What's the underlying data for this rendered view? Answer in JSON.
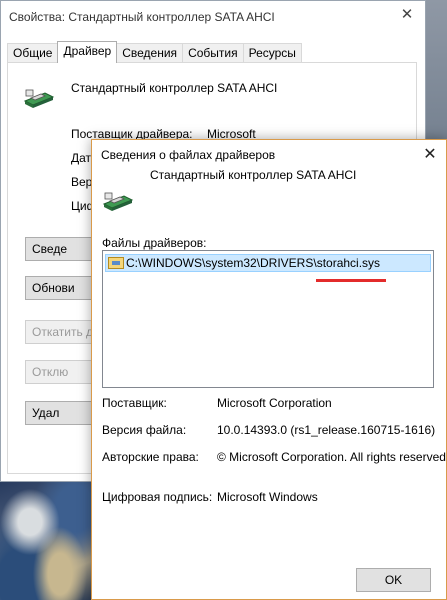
{
  "background_window": {
    "title": "Свойства: Стандартный контроллер SATA AHCI",
    "tabs": [
      "Общие",
      "Драйвер",
      "Сведения",
      "События",
      "Ресурсы"
    ],
    "active_tab": "Драйвер",
    "device_name": "Стандартный контроллер SATA AHCI",
    "provider_label": "Поставщик драйвера:",
    "provider_value": "Microsoft",
    "partial_labels": [
      "Дат",
      "Вер",
      "Циф"
    ],
    "buttons": [
      {
        "label": "Сведе",
        "disabled": false
      },
      {
        "label": "Обнови",
        "disabled": false
      },
      {
        "label": "Откатить д",
        "disabled": true
      },
      {
        "label": "Отклю",
        "disabled": true
      },
      {
        "label": "Удал",
        "disabled": false
      }
    ]
  },
  "dialog": {
    "title": "Сведения о файлах драйверов",
    "device_name": "Стандартный контроллер SATA AHCI",
    "files_label": "Файлы драйверов:",
    "files": [
      "C:\\WINDOWS\\system32\\DRIVERS\\storahci.sys"
    ],
    "details": [
      {
        "label": "Поставщик:",
        "value": "Microsoft Corporation"
      },
      {
        "label": "Версия файла:",
        "value": "10.0.14393.0 (rs1_release.160715-1616)"
      },
      {
        "label": "Авторские права:",
        "value": "© Microsoft Corporation. All rights reserved."
      },
      {
        "label": "Цифровая подпись:",
        "value": "Microsoft Windows"
      }
    ],
    "ok_label": "OK",
    "highlight_color": "#e32b2b"
  },
  "icons": {
    "device": "sata-controller-icon",
    "file": "driver-file-icon",
    "close": "close-icon"
  }
}
